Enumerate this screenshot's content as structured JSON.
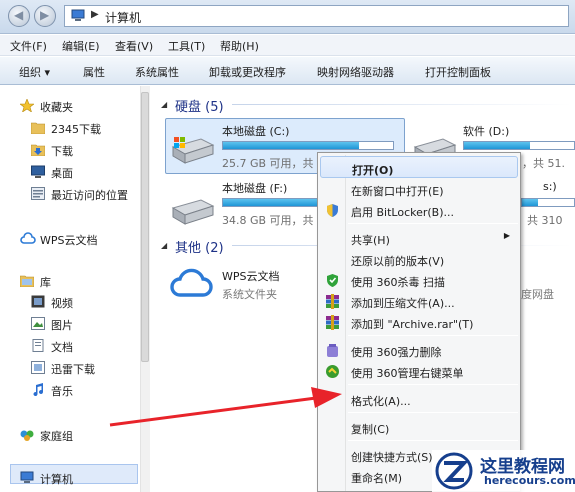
{
  "address": {
    "path": "计算机"
  },
  "menu": [
    "文件(F)",
    "编辑(E)",
    "查看(V)",
    "工具(T)",
    "帮助(H)"
  ],
  "toolbar": [
    "组织 ▾",
    "属性",
    "系统属性",
    "卸载或更改程序",
    "映射网络驱动器",
    "打开控制面板"
  ],
  "sidebar": {
    "favorites": "收藏夹",
    "fav_items": [
      "2345下载",
      "下载",
      "桌面",
      "最近访问的位置"
    ],
    "wps": "WPS云文档",
    "library": "库",
    "lib_items": [
      "视频",
      "图片",
      "文档",
      "迅雷下载",
      "音乐"
    ],
    "homegroup": "家庭组",
    "computer": "计算机"
  },
  "groups": {
    "hdd": "硬盘 (5)",
    "other": "其他 (2)"
  },
  "drives": [
    {
      "name": "本地磁盘 (C:)",
      "size": "25.7 GB 可用，共",
      "used": 0.8
    },
    {
      "name": "软件 (D:)",
      "size": "，共 51.",
      "used": 0.6
    },
    {
      "name": "本地磁盘 (F:)",
      "size": "34.8 GB 可用，共",
      "used": 0.55
    },
    {
      "name": "s:)",
      "size": "共 310",
      "used": 0.3
    }
  ],
  "other_items": [
    {
      "name": "WPS云文档",
      "sub": "系统文件夹"
    },
    {
      "name": "",
      "sub": "度网盘"
    }
  ],
  "context_menu": {
    "open": "打开(O)",
    "open_new": "在新窗口中打开(E)",
    "bitlocker": "启用 BitLocker(B)...",
    "share": "共享(H)",
    "restore": "还原以前的版本(V)",
    "scan360": "使用 360杀毒 扫描",
    "add_zip": "添加到压缩文件(A)...",
    "add_rar": "添加到 \"Archive.rar\"(T)",
    "force_delete": "使用 360强力删除",
    "manage_menu": "使用 360管理右键菜单",
    "format": "格式化(A)...",
    "copy": "复制(C)",
    "shortcut": "创建快捷方式(S)",
    "rename": "重命名(M)"
  },
  "watermark": {
    "title": "这里教程网",
    "url": "herecours.com"
  }
}
